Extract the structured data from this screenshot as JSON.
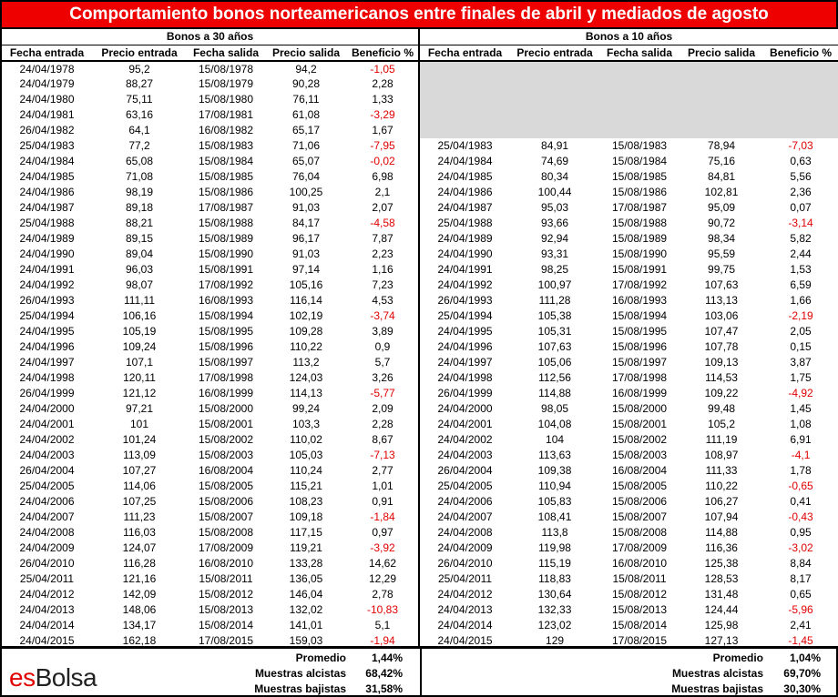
{
  "title": "Comportamiento bonos norteamericanos entre finales de abril y mediados de agosto",
  "group_30": "Bonos a 30 años",
  "group_10": "Bonos a 10 años",
  "headers": [
    "Fecha entrada",
    "Precio entrada",
    "Fecha salida",
    "Precio salida",
    "Beneficio %"
  ],
  "rows": [
    {
      "b30": [
        "24/04/1978",
        "95,2",
        "15/08/1978",
        "94,2",
        "-1,05"
      ],
      "b10": null
    },
    {
      "b30": [
        "24/04/1979",
        "88,27",
        "15/08/1979",
        "90,28",
        "2,28"
      ],
      "b10": null
    },
    {
      "b30": [
        "24/04/1980",
        "75,11",
        "15/08/1980",
        "76,11",
        "1,33"
      ],
      "b10": null
    },
    {
      "b30": [
        "24/04/1981",
        "63,16",
        "17/08/1981",
        "61,08",
        "-3,29"
      ],
      "b10": null
    },
    {
      "b30": [
        "26/04/1982",
        "64,1",
        "16/08/1982",
        "65,17",
        "1,67"
      ],
      "b10": null
    },
    {
      "b30": [
        "25/04/1983",
        "77,2",
        "15/08/1983",
        "71,06",
        "-7,95"
      ],
      "b10": [
        "25/04/1983",
        "84,91",
        "15/08/1983",
        "78,94",
        "-7,03"
      ]
    },
    {
      "b30": [
        "24/04/1984",
        "65,08",
        "15/08/1984",
        "65,07",
        "-0,02"
      ],
      "b10": [
        "24/04/1984",
        "74,69",
        "15/08/1984",
        "75,16",
        "0,63"
      ]
    },
    {
      "b30": [
        "24/04/1985",
        "71,08",
        "15/08/1985",
        "76,04",
        "6,98"
      ],
      "b10": [
        "24/04/1985",
        "80,34",
        "15/08/1985",
        "84,81",
        "5,56"
      ]
    },
    {
      "b30": [
        "24/04/1986",
        "98,19",
        "15/08/1986",
        "100,25",
        "2,1"
      ],
      "b10": [
        "24/04/1986",
        "100,44",
        "15/08/1986",
        "102,81",
        "2,36"
      ]
    },
    {
      "b30": [
        "24/04/1987",
        "89,18",
        "17/08/1987",
        "91,03",
        "2,07"
      ],
      "b10": [
        "24/04/1987",
        "95,03",
        "17/08/1987",
        "95,09",
        "0,07"
      ]
    },
    {
      "b30": [
        "25/04/1988",
        "88,21",
        "15/08/1988",
        "84,17",
        "-4,58"
      ],
      "b10": [
        "25/04/1988",
        "93,66",
        "15/08/1988",
        "90,72",
        "-3,14"
      ]
    },
    {
      "b30": [
        "24/04/1989",
        "89,15",
        "15/08/1989",
        "96,17",
        "7,87"
      ],
      "b10": [
        "24/04/1989",
        "92,94",
        "15/08/1989",
        "98,34",
        "5,82"
      ]
    },
    {
      "b30": [
        "24/04/1990",
        "89,04",
        "15/08/1990",
        "91,03",
        "2,23"
      ],
      "b10": [
        "24/04/1990",
        "93,31",
        "15/08/1990",
        "95,59",
        "2,44"
      ]
    },
    {
      "b30": [
        "24/04/1991",
        "96,03",
        "15/08/1991",
        "97,14",
        "1,16"
      ],
      "b10": [
        "24/04/1991",
        "98,25",
        "15/08/1991",
        "99,75",
        "1,53"
      ]
    },
    {
      "b30": [
        "24/04/1992",
        "98,07",
        "17/08/1992",
        "105,16",
        "7,23"
      ],
      "b10": [
        "24/04/1992",
        "100,97",
        "17/08/1992",
        "107,63",
        "6,59"
      ]
    },
    {
      "b30": [
        "26/04/1993",
        "111,11",
        "16/08/1993",
        "116,14",
        "4,53"
      ],
      "b10": [
        "26/04/1993",
        "111,28",
        "16/08/1993",
        "113,13",
        "1,66"
      ]
    },
    {
      "b30": [
        "25/04/1994",
        "106,16",
        "15/08/1994",
        "102,19",
        "-3,74"
      ],
      "b10": [
        "25/04/1994",
        "105,38",
        "15/08/1994",
        "103,06",
        "-2,19"
      ]
    },
    {
      "b30": [
        "24/04/1995",
        "105,19",
        "15/08/1995",
        "109,28",
        "3,89"
      ],
      "b10": [
        "24/04/1995",
        "105,31",
        "15/08/1995",
        "107,47",
        "2,05"
      ]
    },
    {
      "b30": [
        "24/04/1996",
        "109,24",
        "15/08/1996",
        "110,22",
        "0,9"
      ],
      "b10": [
        "24/04/1996",
        "107,63",
        "15/08/1996",
        "107,78",
        "0,15"
      ]
    },
    {
      "b30": [
        "24/04/1997",
        "107,1",
        "15/08/1997",
        "113,2",
        "5,7"
      ],
      "b10": [
        "24/04/1997",
        "105,06",
        "15/08/1997",
        "109,13",
        "3,87"
      ]
    },
    {
      "b30": [
        "24/04/1998",
        "120,11",
        "17/08/1998",
        "124,03",
        "3,26"
      ],
      "b10": [
        "24/04/1998",
        "112,56",
        "17/08/1998",
        "114,53",
        "1,75"
      ]
    },
    {
      "b30": [
        "26/04/1999",
        "121,12",
        "16/08/1999",
        "114,13",
        "-5,77"
      ],
      "b10": [
        "26/04/1999",
        "114,88",
        "16/08/1999",
        "109,22",
        "-4,92"
      ]
    },
    {
      "b30": [
        "24/04/2000",
        "97,21",
        "15/08/2000",
        "99,24",
        "2,09"
      ],
      "b10": [
        "24/04/2000",
        "98,05",
        "15/08/2000",
        "99,48",
        "1,45"
      ]
    },
    {
      "b30": [
        "24/04/2001",
        "101",
        "15/08/2001",
        "103,3",
        "2,28"
      ],
      "b10": [
        "24/04/2001",
        "104,08",
        "15/08/2001",
        "105,2",
        "1,08"
      ]
    },
    {
      "b30": [
        "24/04/2002",
        "101,24",
        "15/08/2002",
        "110,02",
        "8,67"
      ],
      "b10": [
        "24/04/2002",
        "104",
        "15/08/2002",
        "111,19",
        "6,91"
      ]
    },
    {
      "b30": [
        "24/04/2003",
        "113,09",
        "15/08/2003",
        "105,03",
        "-7,13"
      ],
      "b10": [
        "24/04/2003",
        "113,63",
        "15/08/2003",
        "108,97",
        "-4,1"
      ]
    },
    {
      "b30": [
        "26/04/2004",
        "107,27",
        "16/08/2004",
        "110,24",
        "2,77"
      ],
      "b10": [
        "26/04/2004",
        "109,38",
        "16/08/2004",
        "111,33",
        "1,78"
      ]
    },
    {
      "b30": [
        "25/04/2005",
        "114,06",
        "15/08/2005",
        "115,21",
        "1,01"
      ],
      "b10": [
        "25/04/2005",
        "110,94",
        "15/08/2005",
        "110,22",
        "-0,65"
      ]
    },
    {
      "b30": [
        "24/04/2006",
        "107,25",
        "15/08/2006",
        "108,23",
        "0,91"
      ],
      "b10": [
        "24/04/2006",
        "105,83",
        "15/08/2006",
        "106,27",
        "0,41"
      ]
    },
    {
      "b30": [
        "24/04/2007",
        "111,23",
        "15/08/2007",
        "109,18",
        "-1,84"
      ],
      "b10": [
        "24/04/2007",
        "108,41",
        "15/08/2007",
        "107,94",
        "-0,43"
      ]
    },
    {
      "b30": [
        "24/04/2008",
        "116,03",
        "15/08/2008",
        "117,15",
        "0,97"
      ],
      "b10": [
        "24/04/2008",
        "113,8",
        "15/08/2008",
        "114,88",
        "0,95"
      ]
    },
    {
      "b30": [
        "24/04/2009",
        "124,07",
        "17/08/2009",
        "119,21",
        "-3,92"
      ],
      "b10": [
        "24/04/2009",
        "119,98",
        "17/08/2009",
        "116,36",
        "-3,02"
      ]
    },
    {
      "b30": [
        "26/04/2010",
        "116,28",
        "16/08/2010",
        "133,28",
        "14,62"
      ],
      "b10": [
        "26/04/2010",
        "115,19",
        "16/08/2010",
        "125,38",
        "8,84"
      ]
    },
    {
      "b30": [
        "25/04/2011",
        "121,16",
        "15/08/2011",
        "136,05",
        "12,29"
      ],
      "b10": [
        "25/04/2011",
        "118,83",
        "15/08/2011",
        "128,53",
        "8,17"
      ]
    },
    {
      "b30": [
        "24/04/2012",
        "142,09",
        "15/08/2012",
        "146,04",
        "2,78"
      ],
      "b10": [
        "24/04/2012",
        "130,64",
        "15/08/2012",
        "131,48",
        "0,65"
      ]
    },
    {
      "b30": [
        "24/04/2013",
        "148,06",
        "15/08/2013",
        "132,02",
        "-10,83"
      ],
      "b10": [
        "24/04/2013",
        "132,33",
        "15/08/2013",
        "124,44",
        "-5,96"
      ]
    },
    {
      "b30": [
        "24/04/2014",
        "134,17",
        "15/08/2014",
        "141,01",
        "5,1"
      ],
      "b10": [
        "24/04/2014",
        "123,02",
        "15/08/2014",
        "125,98",
        "2,41"
      ]
    },
    {
      "b30": [
        "24/04/2015",
        "162,18",
        "17/08/2015",
        "159,03",
        "-1,94"
      ],
      "b10": [
        "24/04/2015",
        "129",
        "17/08/2015",
        "127,13",
        "-1,45"
      ]
    }
  ],
  "summary": {
    "labels": [
      "Promedio",
      "Muestras alcistas",
      "Muestras bajistas"
    ],
    "b30": [
      "1,44%",
      "68,42%",
      "31,58%"
    ],
    "b10": [
      "1,04%",
      "69,70%",
      "30,30%"
    ]
  },
  "logo": {
    "part1": "es",
    "part2": "Bolsa"
  },
  "colors": {
    "title_bg": "#ee0000",
    "negative": "#e00000",
    "empty_fill": "#d9d9d9"
  }
}
